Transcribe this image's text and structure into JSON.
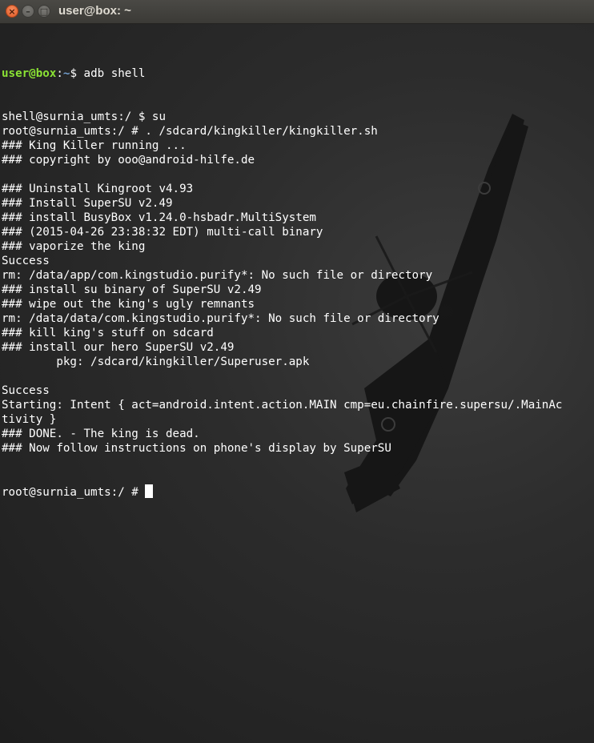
{
  "window": {
    "title": "user@box: ~",
    "close_glyph": "×",
    "minimize_glyph": "–",
    "maximize_glyph": "□"
  },
  "colors": {
    "prompt_user": "#8ae234",
    "prompt_path": "#729fcf",
    "text": "#ffffff",
    "close_button": "#e05a25"
  },
  "terminal": {
    "first_prompt": {
      "user_host": "user@box",
      "separator": ":",
      "path": "~",
      "symbol": "$",
      "command": " adb shell"
    },
    "lines": [
      "shell@surnia_umts:/ $ su",
      "root@surnia_umts:/ # . /sdcard/kingkiller/kingkiller.sh",
      "### King Killer running ...",
      "### copyright by ooo@android-hilfe.de",
      "",
      "### Uninstall Kingroot v4.93",
      "### Install SuperSU v2.49",
      "### install BusyBox v1.24.0-hsbadr.MultiSystem",
      "### (2015-04-26 23:38:32 EDT) multi-call binary",
      "### vaporize the king",
      "Success",
      "rm: /data/app/com.kingstudio.purify*: No such file or directory",
      "### install su binary of SuperSU v2.49",
      "### wipe out the king's ugly remnants",
      "rm: /data/data/com.kingstudio.purify*: No such file or directory",
      "### kill king's stuff on sdcard",
      "### install our hero SuperSU v2.49",
      "        pkg: /sdcard/kingkiller/Superuser.apk",
      "",
      "Success",
      "Starting: Intent { act=android.intent.action.MAIN cmp=eu.chainfire.supersu/.MainAc",
      "tivity }",
      "### DONE. - The king is dead.",
      "### Now follow instructions on phone's display by SuperSU"
    ],
    "final_prompt": "root@surnia_umts:/ # "
  }
}
